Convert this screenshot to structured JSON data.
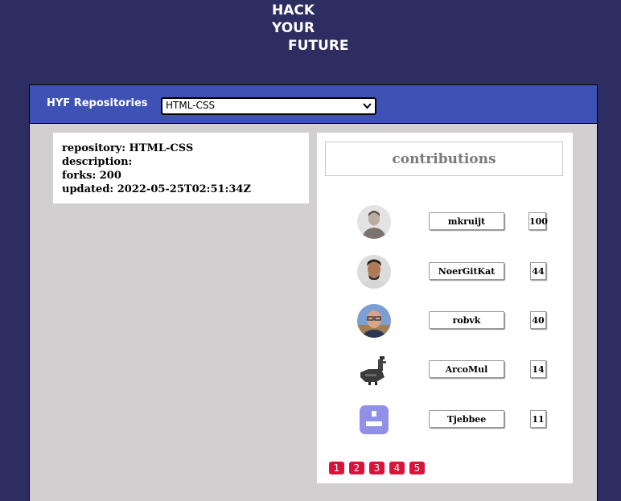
{
  "logo": {
    "line1": "HACK",
    "line2": "YO",
    "line2b": "UR",
    "line3": "FUTURE"
  },
  "header": {
    "title": "HYF Repositories",
    "selected_repo": "HTML-CSS",
    "chevron_icon": "chevron-down-icon"
  },
  "repo_info": {
    "repository": "repository: HTML-CSS",
    "description": "description:",
    "forks": "forks: 200",
    "updated": "updated: 2022-05-25T02:51:34Z"
  },
  "contributions": {
    "title": "contributions",
    "items": [
      {
        "login": "mkruijt",
        "count": "100"
      },
      {
        "login": "NoerGitKat",
        "count": "44"
      },
      {
        "login": "robvk",
        "count": "40"
      },
      {
        "login": "ArcoMul",
        "count": "14"
      },
      {
        "login": "Tjebbee",
        "count": "11"
      }
    ]
  },
  "pagination": [
    "1",
    "2",
    "3",
    "4",
    "5"
  ],
  "colors": {
    "background": "#2e2d62",
    "topbar": "#3e51b5",
    "panel": "#d2cfd0",
    "page_button": "#d9133b"
  }
}
